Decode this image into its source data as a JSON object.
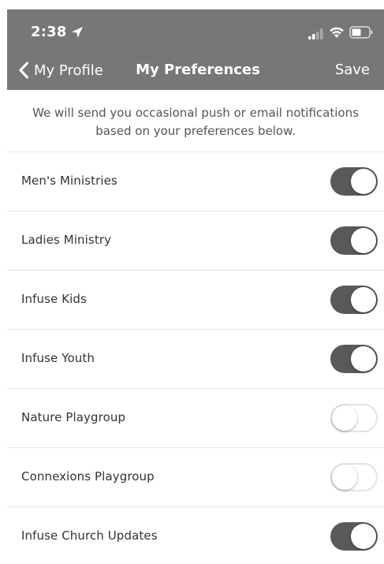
{
  "status_bar": {
    "time": "2:38",
    "icons": [
      "location-arrow-icon",
      "signal-icon",
      "wifi-icon",
      "battery-icon"
    ]
  },
  "nav": {
    "back_label": "My Profile",
    "title": "My Preferences",
    "save_label": "Save"
  },
  "intro": {
    "line1": "We will send you occasional push or email notifications",
    "line2": "based on your preferences below."
  },
  "colors": {
    "header_bg": "#777777",
    "toggle_on": "#595959",
    "toggle_off_border": "#e3e3e3",
    "label_text": "#333333",
    "intro_text": "#555555"
  },
  "preferences": [
    {
      "label": "Men's Ministries",
      "enabled": true
    },
    {
      "label": "Ladies Ministry",
      "enabled": true
    },
    {
      "label": "Infuse Kids",
      "enabled": true
    },
    {
      "label": "Infuse Youth",
      "enabled": true
    },
    {
      "label": "Nature Playgroup",
      "enabled": false
    },
    {
      "label": "Connexions Playgroup",
      "enabled": false
    },
    {
      "label": "Infuse Church Updates",
      "enabled": true
    }
  ]
}
